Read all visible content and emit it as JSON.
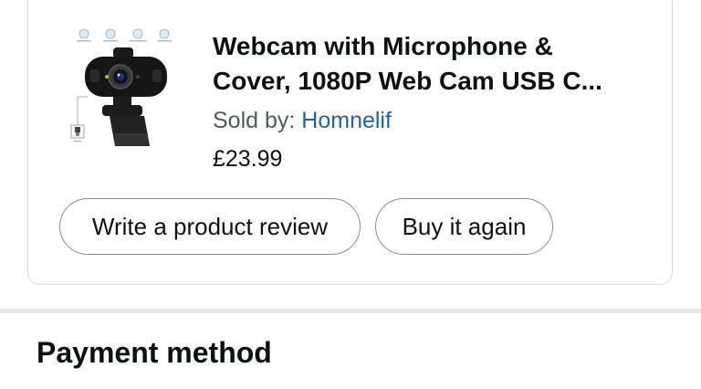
{
  "order_item": {
    "title_line1": "Webcam with Microphone &",
    "title_line2": "Cover, 1080P Web Cam USB C...",
    "sold_by_label": "Sold by: ",
    "seller_name": "Homnelif",
    "price": "£23.99",
    "image_icon": "webcam-product-image"
  },
  "actions": {
    "write_review": "Write a product review",
    "buy_again": "Buy it again"
  },
  "sections": {
    "payment_method": "Payment method"
  },
  "colors": {
    "link": "#2162a1",
    "text": "#0f1111",
    "secondary_text": "#565959",
    "border": "#d5d9d9",
    "button_border": "#888c8c",
    "divider": "#e3e6e6"
  }
}
